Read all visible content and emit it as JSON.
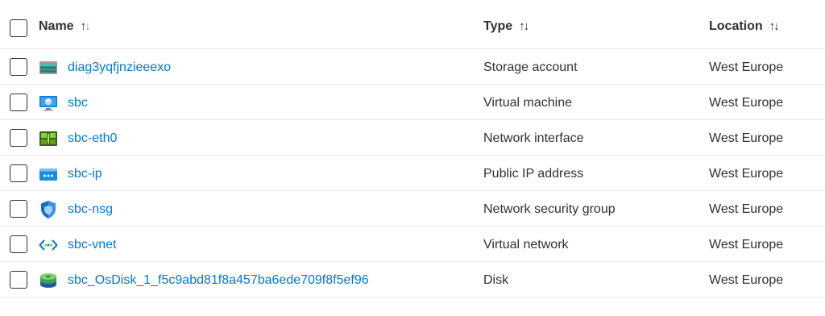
{
  "columns": {
    "name": "Name",
    "type": "Type",
    "location": "Location"
  },
  "sort_glyphs": {
    "up": "↑",
    "down": "↓"
  },
  "rows": [
    {
      "name": "diag3yqfjnzieeexo",
      "type": "Storage account",
      "location": "West Europe",
      "icon": "storage-account-icon"
    },
    {
      "name": "sbc",
      "type": "Virtual machine",
      "location": "West Europe",
      "icon": "virtual-machine-icon"
    },
    {
      "name": "sbc-eth0",
      "type": "Network interface",
      "location": "West Europe",
      "icon": "network-interface-icon"
    },
    {
      "name": "sbc-ip",
      "type": "Public IP address",
      "location": "West Europe",
      "icon": "public-ip-icon"
    },
    {
      "name": "sbc-nsg",
      "type": "Network security group",
      "location": "West Europe",
      "icon": "network-security-group-icon"
    },
    {
      "name": "sbc-vnet",
      "type": "Virtual network",
      "location": "West Europe",
      "icon": "virtual-network-icon"
    },
    {
      "name": "sbc_OsDisk_1_f5c9abd81f8a457ba6ede709f8f5ef96",
      "type": "Disk",
      "location": "West Europe",
      "icon": "disk-icon"
    }
  ],
  "colors": {
    "link": "#0078d4",
    "text": "#323130",
    "divider": "#edebe9"
  }
}
